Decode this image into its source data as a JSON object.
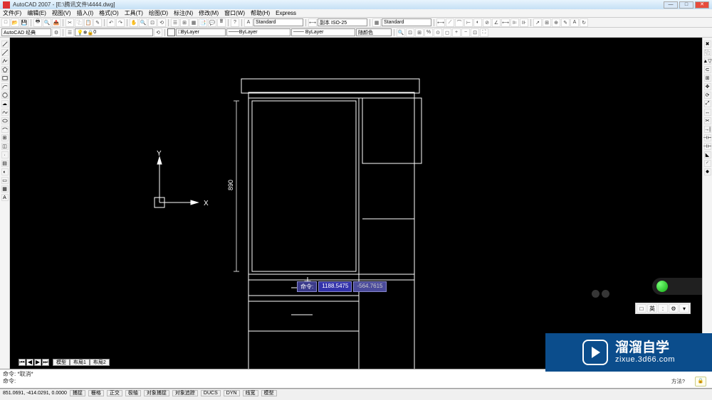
{
  "title": "AutoCAD 2007 - [E:\\腾讯文件\\4444.dwg]",
  "menu": [
    "文件(F)",
    "编辑(E)",
    "视图(V)",
    "插入(I)",
    "格式(O)",
    "工具(T)",
    "绘图(D)",
    "标注(N)",
    "修改(M)",
    "窗口(W)",
    "帮助(H)",
    "Express"
  ],
  "toolbar1": {
    "style1": "Standard",
    "style2": "副本 ISO-25",
    "style3": "Standard"
  },
  "toolbar2": {
    "workspace": "AutoCAD 经典",
    "layer": "0",
    "bylayer1": "ByLayer",
    "bylayer2": "ByLayer",
    "bylayer3": "随颜色"
  },
  "dyninput": {
    "label": "命令:",
    "x": "1188.5475",
    "y": "-564.7615"
  },
  "dimension": "890",
  "axes": {
    "y": "Y",
    "x": "X"
  },
  "navtabs": [
    "模型",
    "布局1",
    "布局2"
  ],
  "cmdlines": {
    "line1": "命令: *取消*",
    "line2": "命令:"
  },
  "status": {
    "coords": "851.0691, -414.0291, 0.0000",
    "buttons": [
      "捕捉",
      "栅格",
      "正交",
      "极轴",
      "对象捕捉",
      "对象追踪",
      "DUCS",
      "DYN",
      "线宽",
      "模型"
    ]
  },
  "lang": [
    "□",
    "英",
    ":",
    "⚙",
    "▾"
  ],
  "watermark": {
    "cn": "溜溜自学",
    "url": "zixue.3d66.com"
  },
  "commtext": "方法?"
}
